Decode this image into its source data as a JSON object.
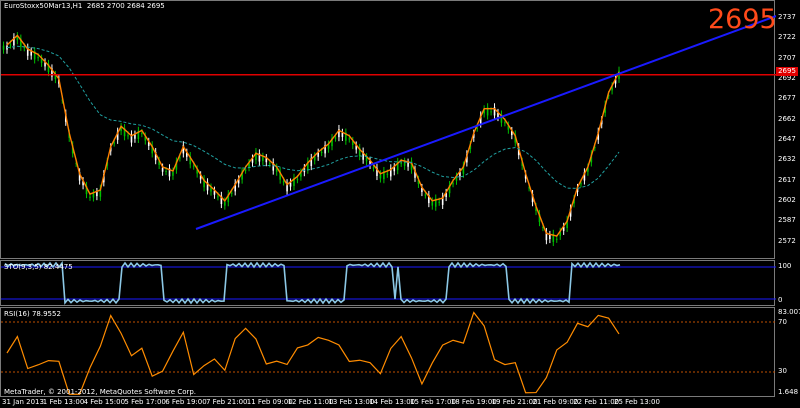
{
  "window": {
    "title": "EuroStoxx50Mar13,H1",
    "ohlc": "2685 2700 2684 2695"
  },
  "big_price": "2695",
  "current_price_tag": "2695",
  "main": {
    "y_ticks": [
      "2737",
      "2722",
      "2707",
      "2692",
      "2677",
      "2662",
      "2647",
      "2632",
      "2617",
      "2602",
      "2587",
      "2572"
    ]
  },
  "stochastic": {
    "label": "STO(9,3,5) 82.4475",
    "y_ticks": [
      "100",
      "0"
    ]
  },
  "rsi": {
    "label": "RSI(16) 78.9552",
    "y_ticks": [
      "83.0075",
      "70",
      "30",
      "1.648"
    ]
  },
  "copyright": "MetaTrader, © 2001-2012, MetaQuotes Software Corp.",
  "x_ticks": [
    "31 Jan 2013",
    "1 Feb 13:00",
    "4 Feb 15:00",
    "5 Feb 17:00",
    "6 Feb 19:00",
    "7 Feb 21:00",
    "11 Feb 09:00",
    "12 Feb 11:00",
    "13 Feb 13:00",
    "14 Feb 13:00",
    "15 Feb 17:00",
    "18 Feb 19:00",
    "19 Feb 21:00",
    "21 Feb 09:00",
    "22 Feb 11:00",
    "25 Feb 13:00"
  ],
  "colors": {
    "bull": "#00c000",
    "bear": "#ffffff",
    "trend": "#1a1aff",
    "hline": "#e00000",
    "ma_fast": "#ff8000",
    "ma_slow": "#20a0a0",
    "stoch": "#8cc8e6",
    "rsi": "#ff8c00"
  },
  "chart_data": {
    "type": "line",
    "title": "EuroStoxx50Mar13,H1",
    "ylim": [
      2565,
      2745
    ],
    "close": [
      2715,
      2722,
      2712,
      2708,
      2700,
      2690,
      2650,
      2620,
      2605,
      2608,
      2640,
      2655,
      2648,
      2652,
      2640,
      2625,
      2622,
      2640,
      2628,
      2615,
      2608,
      2600,
      2612,
      2625,
      2635,
      2632,
      2625,
      2612,
      2618,
      2628,
      2636,
      2642,
      2652,
      2648,
      2638,
      2630,
      2620,
      2623,
      2630,
      2628,
      2610,
      2600,
      2602,
      2615,
      2625,
      2650,
      2668,
      2668,
      2660,
      2648,
      2620,
      2596,
      2576,
      2574,
      2585,
      2610,
      2625,
      2650,
      2680,
      2695
    ],
    "horizontal_line": 2695
  }
}
